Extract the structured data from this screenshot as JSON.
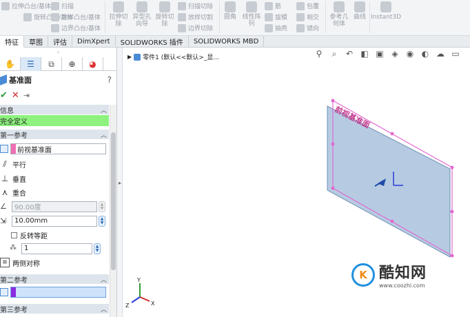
{
  "ribbon": {
    "items": [
      {
        "label": "拉伸凸台/基体"
      },
      {
        "label": "旋转凸台/基体"
      },
      {
        "label": "扫描"
      },
      {
        "label": "放样凸台/基体"
      },
      {
        "label": "边界凸台/基体"
      },
      {
        "label": "拉伸切除"
      },
      {
        "label": "异型孔向导"
      },
      {
        "label": "旋转切除"
      },
      {
        "label": "扫描切除"
      },
      {
        "label": "放样切割"
      },
      {
        "label": "边界切除"
      },
      {
        "label": "圆角"
      },
      {
        "label": "线性阵列"
      },
      {
        "label": "筋"
      },
      {
        "label": "拔模"
      },
      {
        "label": "抽壳"
      },
      {
        "label": "包覆"
      },
      {
        "label": "相交"
      },
      {
        "label": "镜向"
      },
      {
        "label": "参考几何体"
      },
      {
        "label": "曲线"
      },
      {
        "label": "Instant3D"
      }
    ]
  },
  "tabs": [
    {
      "label": "特征"
    },
    {
      "label": "草图"
    },
    {
      "label": "评估"
    },
    {
      "label": "DimXpert"
    },
    {
      "label": "SOLIDWORKS 插件"
    },
    {
      "label": "SOLIDWORKS MBD"
    }
  ],
  "propertyManager": {
    "title": "基准面",
    "help": "?",
    "messageGroup": {
      "title": "信息",
      "text": "完全定义"
    },
    "firstRef": {
      "title": "第一参考",
      "value": "前视基准面",
      "swatchColor": "#f06eb4",
      "options": [
        {
          "label": "平行",
          "icon": "parallel-icon",
          "glyph": "⫽"
        },
        {
          "label": "垂直",
          "icon": "perpendicular-icon",
          "glyph": "⊥"
        },
        {
          "label": "重合",
          "icon": "coincident-icon",
          "glyph": "⋏"
        }
      ],
      "angle": "90.00度",
      "distance": "10.00mm",
      "flipLabel": "反转等距",
      "count": "1",
      "midPlaneLabel": "两侧对称"
    },
    "secondRef": {
      "title": "第二参考",
      "value": "",
      "swatchColor": "#8b2be2"
    },
    "thirdRef": {
      "title": "第三参考"
    }
  },
  "viewport": {
    "tree": {
      "label": "零件1  (默认<<默认>_显..."
    },
    "planeLabel": "前视基准面",
    "planeFill": "#a9c2dd",
    "planeEdge": "#e26ad0",
    "triad": {
      "x": "X",
      "y": "Y",
      "z": "Z"
    }
  },
  "watermark": {
    "logo": "K",
    "brand": "酷知网",
    "url": "www.coozhi.com"
  },
  "colors": {
    "accent": "#1e8fe0",
    "ok": "#2c9c3a",
    "cancel": "#cc2b2b",
    "messageBg": "#8df27e"
  }
}
